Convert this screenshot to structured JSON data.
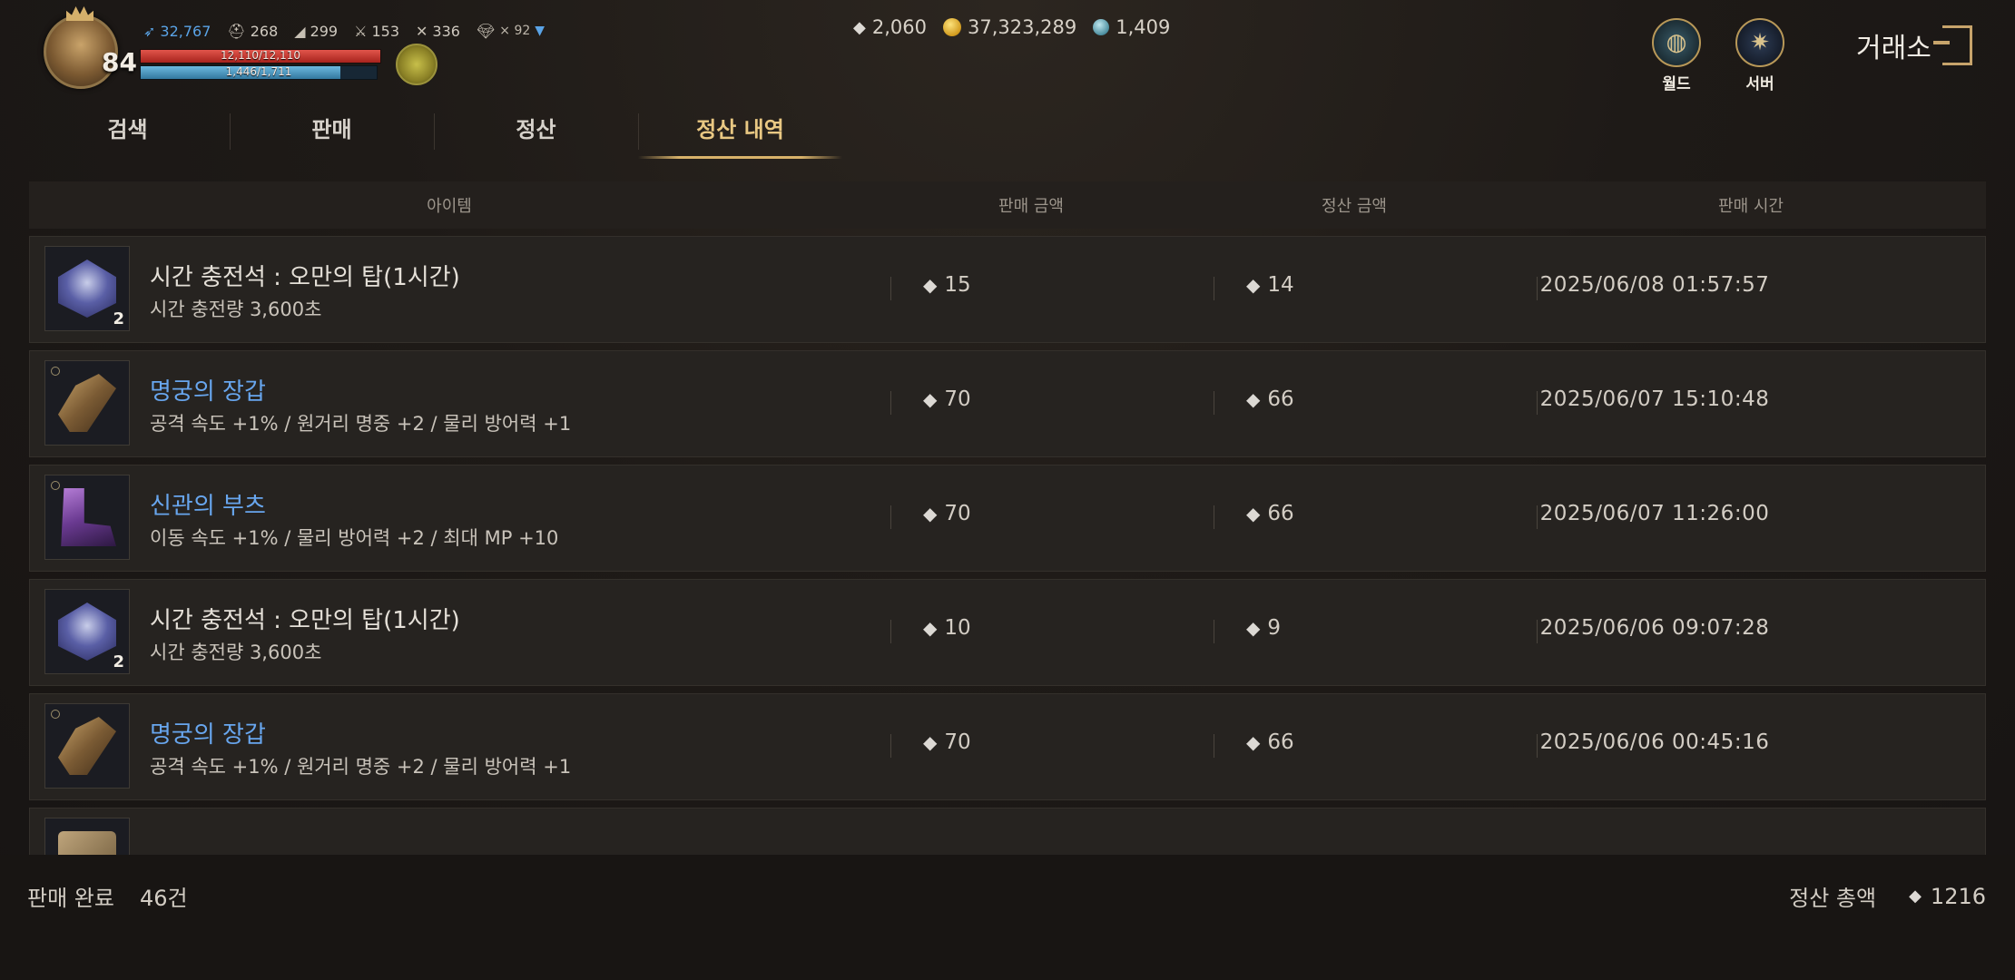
{
  "player": {
    "level": "84",
    "stats": [
      {
        "icon": "feather-icon",
        "value": "32,767",
        "blue": true
      },
      {
        "icon": "helmet-icon",
        "value": "268",
        "blue": false
      },
      {
        "icon": "wing-icon",
        "value": "299",
        "blue": false
      },
      {
        "icon": "swords-icon",
        "value": "153",
        "blue": false
      },
      {
        "icon": "crossed-axes-icon",
        "value": "336",
        "blue": false
      }
    ],
    "buff": "× 92",
    "hp_text": "12,110/12,110",
    "hp_fraction": 1.0,
    "mp_text": "1,446/1,711",
    "mp_fraction": 0.845
  },
  "currency": {
    "diamond": "2,060",
    "gold": "37,323,289",
    "gem": "1,409"
  },
  "menu": {
    "world_label": "월드",
    "server_label": "서버",
    "title": "거래소"
  },
  "tabs": [
    {
      "label": "검색"
    },
    {
      "label": "판매"
    },
    {
      "label": "정산"
    },
    {
      "label": "정산 내역"
    }
  ],
  "table": {
    "headers": {
      "item": "아이템",
      "sale_price": "판매 금액",
      "settle_amount": "정산 금액",
      "sale_time": "판매 시간"
    },
    "rows": [
      {
        "name": "시간 충전석 : 오만의 탑(1시간)",
        "desc": "시간 충전량 3,600초",
        "price": "15",
        "settle": "14",
        "time": "2025/06/08 01:57:57",
        "qty": "2"
      },
      {
        "name": "명궁의 장갑",
        "desc": "공격 속도 +1% / 원거리 명중 +2 / 물리 방어력 +1",
        "price": "70",
        "settle": "66",
        "time": "2025/06/07 15:10:48",
        "qty": ""
      },
      {
        "name": "신관의 부츠",
        "desc": "이동 속도 +1% / 물리 방어력 +2 / 최대 MP +10",
        "price": "70",
        "settle": "66",
        "time": "2025/06/07 11:26:00",
        "qty": ""
      },
      {
        "name": "시간 충전석 : 오만의 탑(1시간)",
        "desc": "시간 충전량 3,600초",
        "price": "10",
        "settle": "9",
        "time": "2025/06/06 09:07:28",
        "qty": "2"
      },
      {
        "name": "명궁의 장갑",
        "desc": "공격 속도 +1% / 원거리 명중 +2 / 물리 방어력 +1",
        "price": "70",
        "settle": "66",
        "time": "2025/06/06 00:45:16",
        "qty": ""
      }
    ]
  },
  "footer": {
    "done_label": "판매 완료",
    "done_count": "46건",
    "total_label": "정산 총액",
    "total_value": "1216"
  },
  "colors": {
    "accent_gold": "#e9c883",
    "item_blue": "#68a6ee",
    "hp_red": "#c9352c",
    "mp_blue": "#4a9cc8"
  }
}
